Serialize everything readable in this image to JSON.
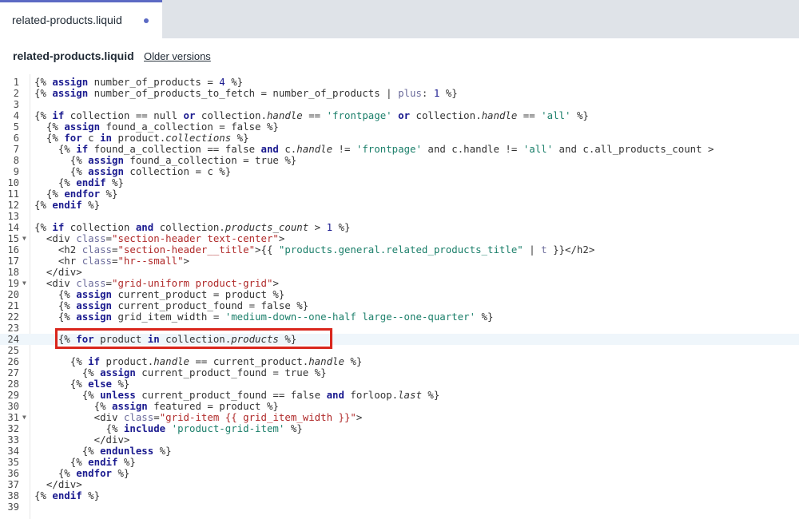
{
  "tab": {
    "label": "related-products.liquid"
  },
  "header": {
    "filename": "related-products.liquid",
    "older_versions": "Older versions"
  },
  "colors": {
    "accent": "#5c6ac4",
    "highlight": "#d9261c",
    "tabbar_bg": "#dfe3e8"
  },
  "editor": {
    "active_line": 24,
    "highlighted_line": 24,
    "lines": [
      {
        "n": "1",
        "indent": "",
        "fold": false,
        "tokens": [
          [
            "p",
            "{% "
          ],
          [
            "k",
            "assign"
          ],
          [
            "v",
            " number_of_products = "
          ],
          [
            "n",
            "4"
          ],
          [
            "p",
            " %}"
          ]
        ]
      },
      {
        "n": "2",
        "indent": "",
        "fold": false,
        "tokens": [
          [
            "p",
            "{% "
          ],
          [
            "k",
            "assign"
          ],
          [
            "v",
            " number_of_products_to_fetch = number_of_products | "
          ],
          [
            "f",
            "plus"
          ],
          [
            "v",
            ": "
          ],
          [
            "n",
            "1"
          ],
          [
            "p",
            " %}"
          ]
        ]
      },
      {
        "n": "3",
        "indent": "",
        "fold": false,
        "tokens": []
      },
      {
        "n": "4",
        "indent": "",
        "fold": false,
        "tokens": [
          [
            "p",
            "{% "
          ],
          [
            "k",
            "if"
          ],
          [
            "v",
            " collection == null "
          ],
          [
            "k",
            "or"
          ],
          [
            "v",
            " collection."
          ],
          [
            "i",
            "handle"
          ],
          [
            "v",
            " == "
          ],
          [
            "s",
            "'frontpage'"
          ],
          [
            "v",
            " "
          ],
          [
            "k",
            "or"
          ],
          [
            "v",
            " collection."
          ],
          [
            "i",
            "handle"
          ],
          [
            "v",
            " == "
          ],
          [
            "s",
            "'all'"
          ],
          [
            "p",
            " %}"
          ]
        ]
      },
      {
        "n": "5",
        "indent": "  ",
        "fold": false,
        "tokens": [
          [
            "p",
            "{% "
          ],
          [
            "k",
            "assign"
          ],
          [
            "v",
            " found_a_collection = false "
          ],
          [
            "p",
            "%}"
          ]
        ]
      },
      {
        "n": "6",
        "indent": "  ",
        "fold": false,
        "tokens": [
          [
            "p",
            "{% "
          ],
          [
            "k",
            "for"
          ],
          [
            "v",
            " c "
          ],
          [
            "k",
            "in"
          ],
          [
            "v",
            " product."
          ],
          [
            "i",
            "collections"
          ],
          [
            "p",
            " %}"
          ]
        ]
      },
      {
        "n": "7",
        "indent": "    ",
        "fold": false,
        "tokens": [
          [
            "p",
            "{% "
          ],
          [
            "k",
            "if"
          ],
          [
            "v",
            " found_a_collection == false "
          ],
          [
            "k",
            "and"
          ],
          [
            "v",
            " c."
          ],
          [
            "i",
            "handle"
          ],
          [
            "v",
            " != "
          ],
          [
            "s",
            "'frontpage'"
          ],
          [
            "v",
            " and c.handle != "
          ],
          [
            "s",
            "'all'"
          ],
          [
            "v",
            " and c.all_products_count >"
          ]
        ]
      },
      {
        "n": "8",
        "indent": "      ",
        "fold": false,
        "tokens": [
          [
            "p",
            "{% "
          ],
          [
            "k",
            "assign"
          ],
          [
            "v",
            " found_a_collection = true "
          ],
          [
            "p",
            "%}"
          ]
        ]
      },
      {
        "n": "9",
        "indent": "      ",
        "fold": false,
        "tokens": [
          [
            "p",
            "{% "
          ],
          [
            "k",
            "assign"
          ],
          [
            "v",
            " collection = c "
          ],
          [
            "p",
            "%}"
          ]
        ]
      },
      {
        "n": "10",
        "indent": "    ",
        "fold": false,
        "tokens": [
          [
            "p",
            "{% "
          ],
          [
            "k",
            "endif"
          ],
          [
            "p",
            " %}"
          ]
        ]
      },
      {
        "n": "11",
        "indent": "  ",
        "fold": false,
        "tokens": [
          [
            "p",
            "{% "
          ],
          [
            "k",
            "endfor"
          ],
          [
            "p",
            " %}"
          ]
        ]
      },
      {
        "n": "12",
        "indent": "",
        "fold": false,
        "tokens": [
          [
            "p",
            "{% "
          ],
          [
            "k",
            "endif"
          ],
          [
            "p",
            " %}"
          ]
        ]
      },
      {
        "n": "13",
        "indent": "",
        "fold": false,
        "tokens": []
      },
      {
        "n": "14",
        "indent": "",
        "fold": false,
        "tokens": [
          [
            "p",
            "{% "
          ],
          [
            "k",
            "if"
          ],
          [
            "v",
            " collection "
          ],
          [
            "k",
            "and"
          ],
          [
            "v",
            " collection."
          ],
          [
            "i",
            "products_count"
          ],
          [
            "v",
            " > "
          ],
          [
            "n",
            "1"
          ],
          [
            "p",
            " %}"
          ]
        ]
      },
      {
        "n": "15",
        "indent": "  ",
        "fold": true,
        "tokens": [
          [
            "v",
            "<div "
          ],
          [
            "f",
            "class"
          ],
          [
            "v",
            "="
          ],
          [
            "a",
            "\"section-header text-center\""
          ],
          [
            "v",
            ">"
          ]
        ]
      },
      {
        "n": "16",
        "indent": "    ",
        "fold": false,
        "tokens": [
          [
            "v",
            "<h2 "
          ],
          [
            "f",
            "class"
          ],
          [
            "v",
            "="
          ],
          [
            "a",
            "\"section-header__title\""
          ],
          [
            "v",
            ">{{ "
          ],
          [
            "s",
            "\"products.general.related_products_title\""
          ],
          [
            "v",
            " | "
          ],
          [
            "f",
            "t"
          ],
          [
            "v",
            " }}</h2>"
          ]
        ]
      },
      {
        "n": "17",
        "indent": "    ",
        "fold": false,
        "tokens": [
          [
            "v",
            "<hr "
          ],
          [
            "f",
            "class"
          ],
          [
            "v",
            "="
          ],
          [
            "a",
            "\"hr--small\""
          ],
          [
            "v",
            ">"
          ]
        ]
      },
      {
        "n": "18",
        "indent": "  ",
        "fold": false,
        "tokens": [
          [
            "v",
            "</div>"
          ]
        ]
      },
      {
        "n": "19",
        "indent": "  ",
        "fold": true,
        "tokens": [
          [
            "v",
            "<div "
          ],
          [
            "f",
            "class"
          ],
          [
            "v",
            "="
          ],
          [
            "a",
            "\"grid-uniform product-grid\""
          ],
          [
            "v",
            ">"
          ]
        ]
      },
      {
        "n": "20",
        "indent": "    ",
        "fold": false,
        "tokens": [
          [
            "p",
            "{% "
          ],
          [
            "k",
            "assign"
          ],
          [
            "v",
            " current_product = product "
          ],
          [
            "p",
            "%}"
          ]
        ]
      },
      {
        "n": "21",
        "indent": "    ",
        "fold": false,
        "tokens": [
          [
            "p",
            "{% "
          ],
          [
            "k",
            "assign"
          ],
          [
            "v",
            " current_product_found = false "
          ],
          [
            "p",
            "%}"
          ]
        ]
      },
      {
        "n": "22",
        "indent": "    ",
        "fold": false,
        "tokens": [
          [
            "p",
            "{% "
          ],
          [
            "k",
            "assign"
          ],
          [
            "v",
            " grid_item_width = "
          ],
          [
            "s",
            "'medium-down--one-half large--one-quarter'"
          ],
          [
            "p",
            " %}"
          ]
        ]
      },
      {
        "n": "23",
        "indent": "",
        "fold": false,
        "tokens": []
      },
      {
        "n": "24",
        "indent": "    ",
        "fold": false,
        "tokens": [
          [
            "p",
            "{% "
          ],
          [
            "k",
            "for"
          ],
          [
            "v",
            " product "
          ],
          [
            "k",
            "in"
          ],
          [
            "v",
            " collection."
          ],
          [
            "i",
            "products"
          ],
          [
            "p",
            " %}"
          ]
        ]
      },
      {
        "n": "25",
        "indent": "",
        "fold": false,
        "tokens": []
      },
      {
        "n": "26",
        "indent": "      ",
        "fold": false,
        "tokens": [
          [
            "p",
            "{% "
          ],
          [
            "k",
            "if"
          ],
          [
            "v",
            " product."
          ],
          [
            "i",
            "handle"
          ],
          [
            "v",
            " == current_product."
          ],
          [
            "i",
            "handle"
          ],
          [
            "p",
            " %}"
          ]
        ]
      },
      {
        "n": "27",
        "indent": "        ",
        "fold": false,
        "tokens": [
          [
            "p",
            "{% "
          ],
          [
            "k",
            "assign"
          ],
          [
            "v",
            " current_product_found = true "
          ],
          [
            "p",
            "%}"
          ]
        ]
      },
      {
        "n": "28",
        "indent": "      ",
        "fold": false,
        "tokens": [
          [
            "p",
            "{% "
          ],
          [
            "k",
            "else"
          ],
          [
            "p",
            " %}"
          ]
        ]
      },
      {
        "n": "29",
        "indent": "        ",
        "fold": false,
        "tokens": [
          [
            "p",
            "{% "
          ],
          [
            "k",
            "unless"
          ],
          [
            "v",
            " current_product_found == false "
          ],
          [
            "k",
            "and"
          ],
          [
            "v",
            " forloop."
          ],
          [
            "i",
            "last"
          ],
          [
            "p",
            " %}"
          ]
        ]
      },
      {
        "n": "30",
        "indent": "          ",
        "fold": false,
        "tokens": [
          [
            "p",
            "{% "
          ],
          [
            "k",
            "assign"
          ],
          [
            "v",
            " featured = product "
          ],
          [
            "p",
            "%}"
          ]
        ]
      },
      {
        "n": "31",
        "indent": "          ",
        "fold": true,
        "tokens": [
          [
            "v",
            "<div "
          ],
          [
            "f",
            "class"
          ],
          [
            "v",
            "="
          ],
          [
            "a",
            "\"grid-item {{ grid_item_width }}\""
          ],
          [
            "v",
            ">"
          ]
        ]
      },
      {
        "n": "32",
        "indent": "            ",
        "fold": false,
        "tokens": [
          [
            "p",
            "{% "
          ],
          [
            "k",
            "include"
          ],
          [
            "v",
            " "
          ],
          [
            "s",
            "'product-grid-item'"
          ],
          [
            "p",
            " %}"
          ]
        ]
      },
      {
        "n": "33",
        "indent": "          ",
        "fold": false,
        "tokens": [
          [
            "v",
            "</div>"
          ]
        ]
      },
      {
        "n": "34",
        "indent": "        ",
        "fold": false,
        "tokens": [
          [
            "p",
            "{% "
          ],
          [
            "k",
            "endunless"
          ],
          [
            "p",
            " %}"
          ]
        ]
      },
      {
        "n": "35",
        "indent": "      ",
        "fold": false,
        "tokens": [
          [
            "p",
            "{% "
          ],
          [
            "k",
            "endif"
          ],
          [
            "p",
            " %}"
          ]
        ]
      },
      {
        "n": "36",
        "indent": "    ",
        "fold": false,
        "tokens": [
          [
            "p",
            "{% "
          ],
          [
            "k",
            "endfor"
          ],
          [
            "p",
            " %}"
          ]
        ]
      },
      {
        "n": "37",
        "indent": "  ",
        "fold": false,
        "tokens": [
          [
            "v",
            "</div>"
          ]
        ]
      },
      {
        "n": "38",
        "indent": "",
        "fold": false,
        "tokens": [
          [
            "p",
            "{% "
          ],
          [
            "k",
            "endif"
          ],
          [
            "p",
            " %}"
          ]
        ]
      },
      {
        "n": "39",
        "indent": "",
        "fold": false,
        "tokens": []
      }
    ]
  }
}
